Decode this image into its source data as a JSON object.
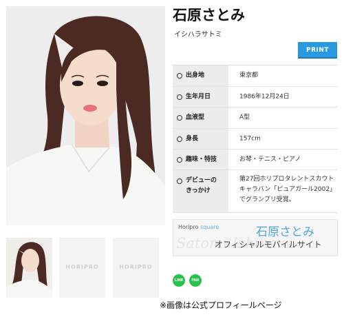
{
  "profile_header": {
    "name": "石原さとみ",
    "name_kana": "イシハラサトミ",
    "print_label": "PRINT"
  },
  "profile_rows": [
    {
      "label": "出身地",
      "value": "東京都"
    },
    {
      "label": "生年月日",
      "value": "1986年12月24日"
    },
    {
      "label": "血液型",
      "value": "A型"
    },
    {
      "label": "身長",
      "value": "157cm"
    },
    {
      "label": "趣味・特技",
      "value": "お琴・テニス・ピアノ"
    },
    {
      "label": "デビューの\nきっかけ",
      "value": "第27回ホリプロタレントスカウトキャラバン「ピュアガール2002」でグランプリ受賞。"
    }
  ],
  "thumbnails": {
    "placeholder_logo": "HORIPRO"
  },
  "banner": {
    "brand_text": "Horipro ",
    "brand_accent": "square",
    "name": "石原さとみ",
    "subtitle": "オフィシャルモバイルサイト",
    "signature": "Satomi Ishihara"
  },
  "sns": {
    "line_label": "LINE",
    "fan_label": "FAN"
  },
  "caption": "※画像は公式プロフィールページ",
  "colors": {
    "print_button": "#2a9ae0",
    "sns_green": "#27c24c",
    "label_bg": "#ececec",
    "banner_name": "#4aa8de"
  }
}
